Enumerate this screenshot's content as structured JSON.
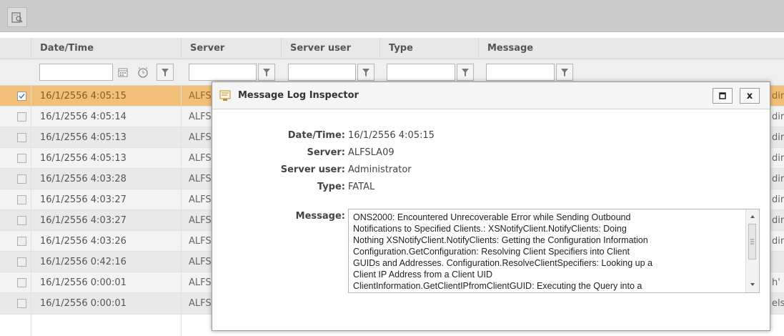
{
  "toolbar": {
    "inspect_icon": "inspect-icon"
  },
  "columns": {
    "datetime": "Date/Time",
    "server": "Server",
    "server_user": "Server user",
    "type": "Type",
    "message": "Message"
  },
  "rows": [
    {
      "datetime": "16/1/2556 4:05:15",
      "server": "ALFS",
      "msg": "dir",
      "selected": true
    },
    {
      "datetime": "16/1/2556 4:05:14",
      "server": "ALFS",
      "msg": "dir"
    },
    {
      "datetime": "16/1/2556 4:05:13",
      "server": "ALFS",
      "msg": "dir"
    },
    {
      "datetime": "16/1/2556 4:05:13",
      "server": "ALFS",
      "msg": "dir"
    },
    {
      "datetime": "16/1/2556 4:03:28",
      "server": "ALFS",
      "msg": "dir"
    },
    {
      "datetime": "16/1/2556 4:03:27",
      "server": "ALFS",
      "msg": "dir"
    },
    {
      "datetime": "16/1/2556 4:03:27",
      "server": "ALFS",
      "msg": "dir"
    },
    {
      "datetime": "16/1/2556 4:03:26",
      "server": "ALFS",
      "msg": "dir"
    },
    {
      "datetime": "16/1/2556 0:42:16",
      "server": "ALFS",
      "msg": ""
    },
    {
      "datetime": "16/1/2556 0:00:01",
      "server": "ALFS",
      "msg": "h'"
    },
    {
      "datetime": "16/1/2556 0:00:01",
      "server": "ALFS",
      "msg": "els"
    }
  ],
  "dialog": {
    "title": "Message Log Inspector",
    "labels": {
      "datetime": "Date/Time:",
      "server": "Server:",
      "server_user": "Server user:",
      "type": "Type:",
      "message": "Message:"
    },
    "values": {
      "datetime": "16/1/2556 4:05:15",
      "server": "ALFSLA09",
      "server_user": "Administrator",
      "type": "FATAL"
    },
    "message_lines": [
      "ONS2000: Encountered Unrecoverable Error while Sending Outbound",
      "Notifications to Specified Clients.:   XSNotifyClient.NotifyClients: Doing",
      "Nothing XSNotifyClient.NotifyClients: Getting the Configuration Information",
      "Configuration.GetConfiguration: Resolving Client Specifiers into Client",
      "GUIDs and Addresses. Configuration.ResolveClientSpecifiers: Looking up a",
      "Client IP Address from a Client UID",
      "ClientInformation.GetClientIPfromClientGUID: Executing the Query into a"
    ],
    "maximize_label": "□",
    "close_label": "x"
  },
  "colors": {
    "selected_row": "#f1bf78",
    "toolbar": "#cccccc"
  }
}
